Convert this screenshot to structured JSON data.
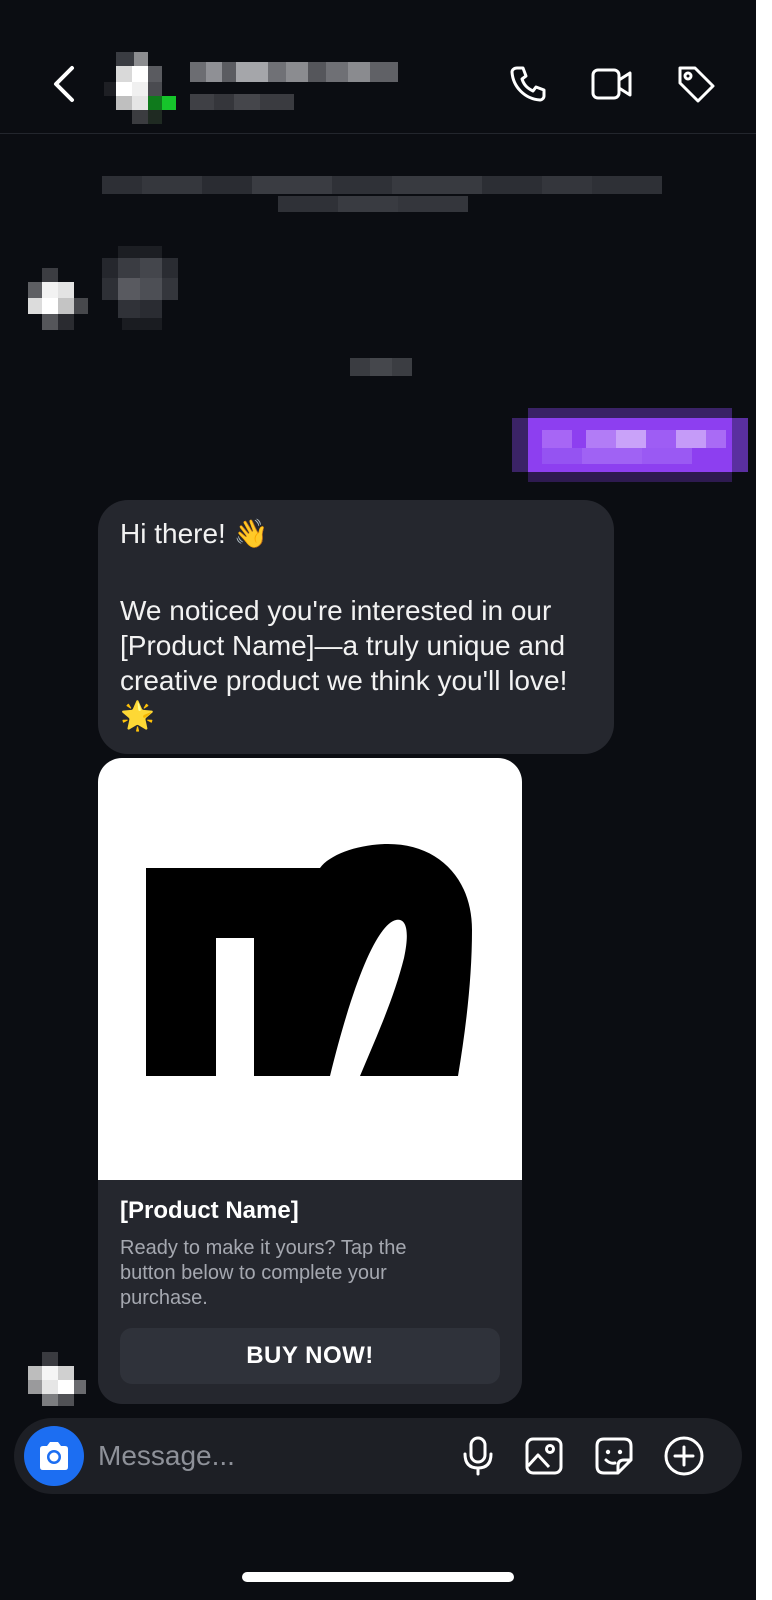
{
  "header": {
    "back_icon": "chevron-left-icon",
    "call_icon": "phone-icon",
    "video_icon": "video-camera-icon",
    "tag_icon": "tag-icon"
  },
  "messages": {
    "greeting": "Hi there! 👋",
    "body_lines": [
      "We noticed you're interested in our",
      "[Product Name]—a truly unique and",
      "creative product we think you'll love!",
      "🌟"
    ]
  },
  "card": {
    "title": "[Product Name]",
    "description_lines": [
      "Ready to make it yours? Tap the",
      "button below to complete your",
      "purchase."
    ],
    "button_label": "BUY NOW!"
  },
  "composer": {
    "placeholder": "Message...",
    "value": "",
    "camera_icon": "camera-icon",
    "mic_icon": "microphone-icon",
    "gallery_icon": "image-icon",
    "sticker_icon": "sticker-icon",
    "plus_icon": "plus-circle-icon"
  },
  "colors": {
    "background": "#0b0d12",
    "bubble": "#25272e",
    "outgoing_bubble": "#8a3ff0",
    "accent_camera": "#1c6ef2",
    "secondary_text": "#a5a8b0"
  }
}
